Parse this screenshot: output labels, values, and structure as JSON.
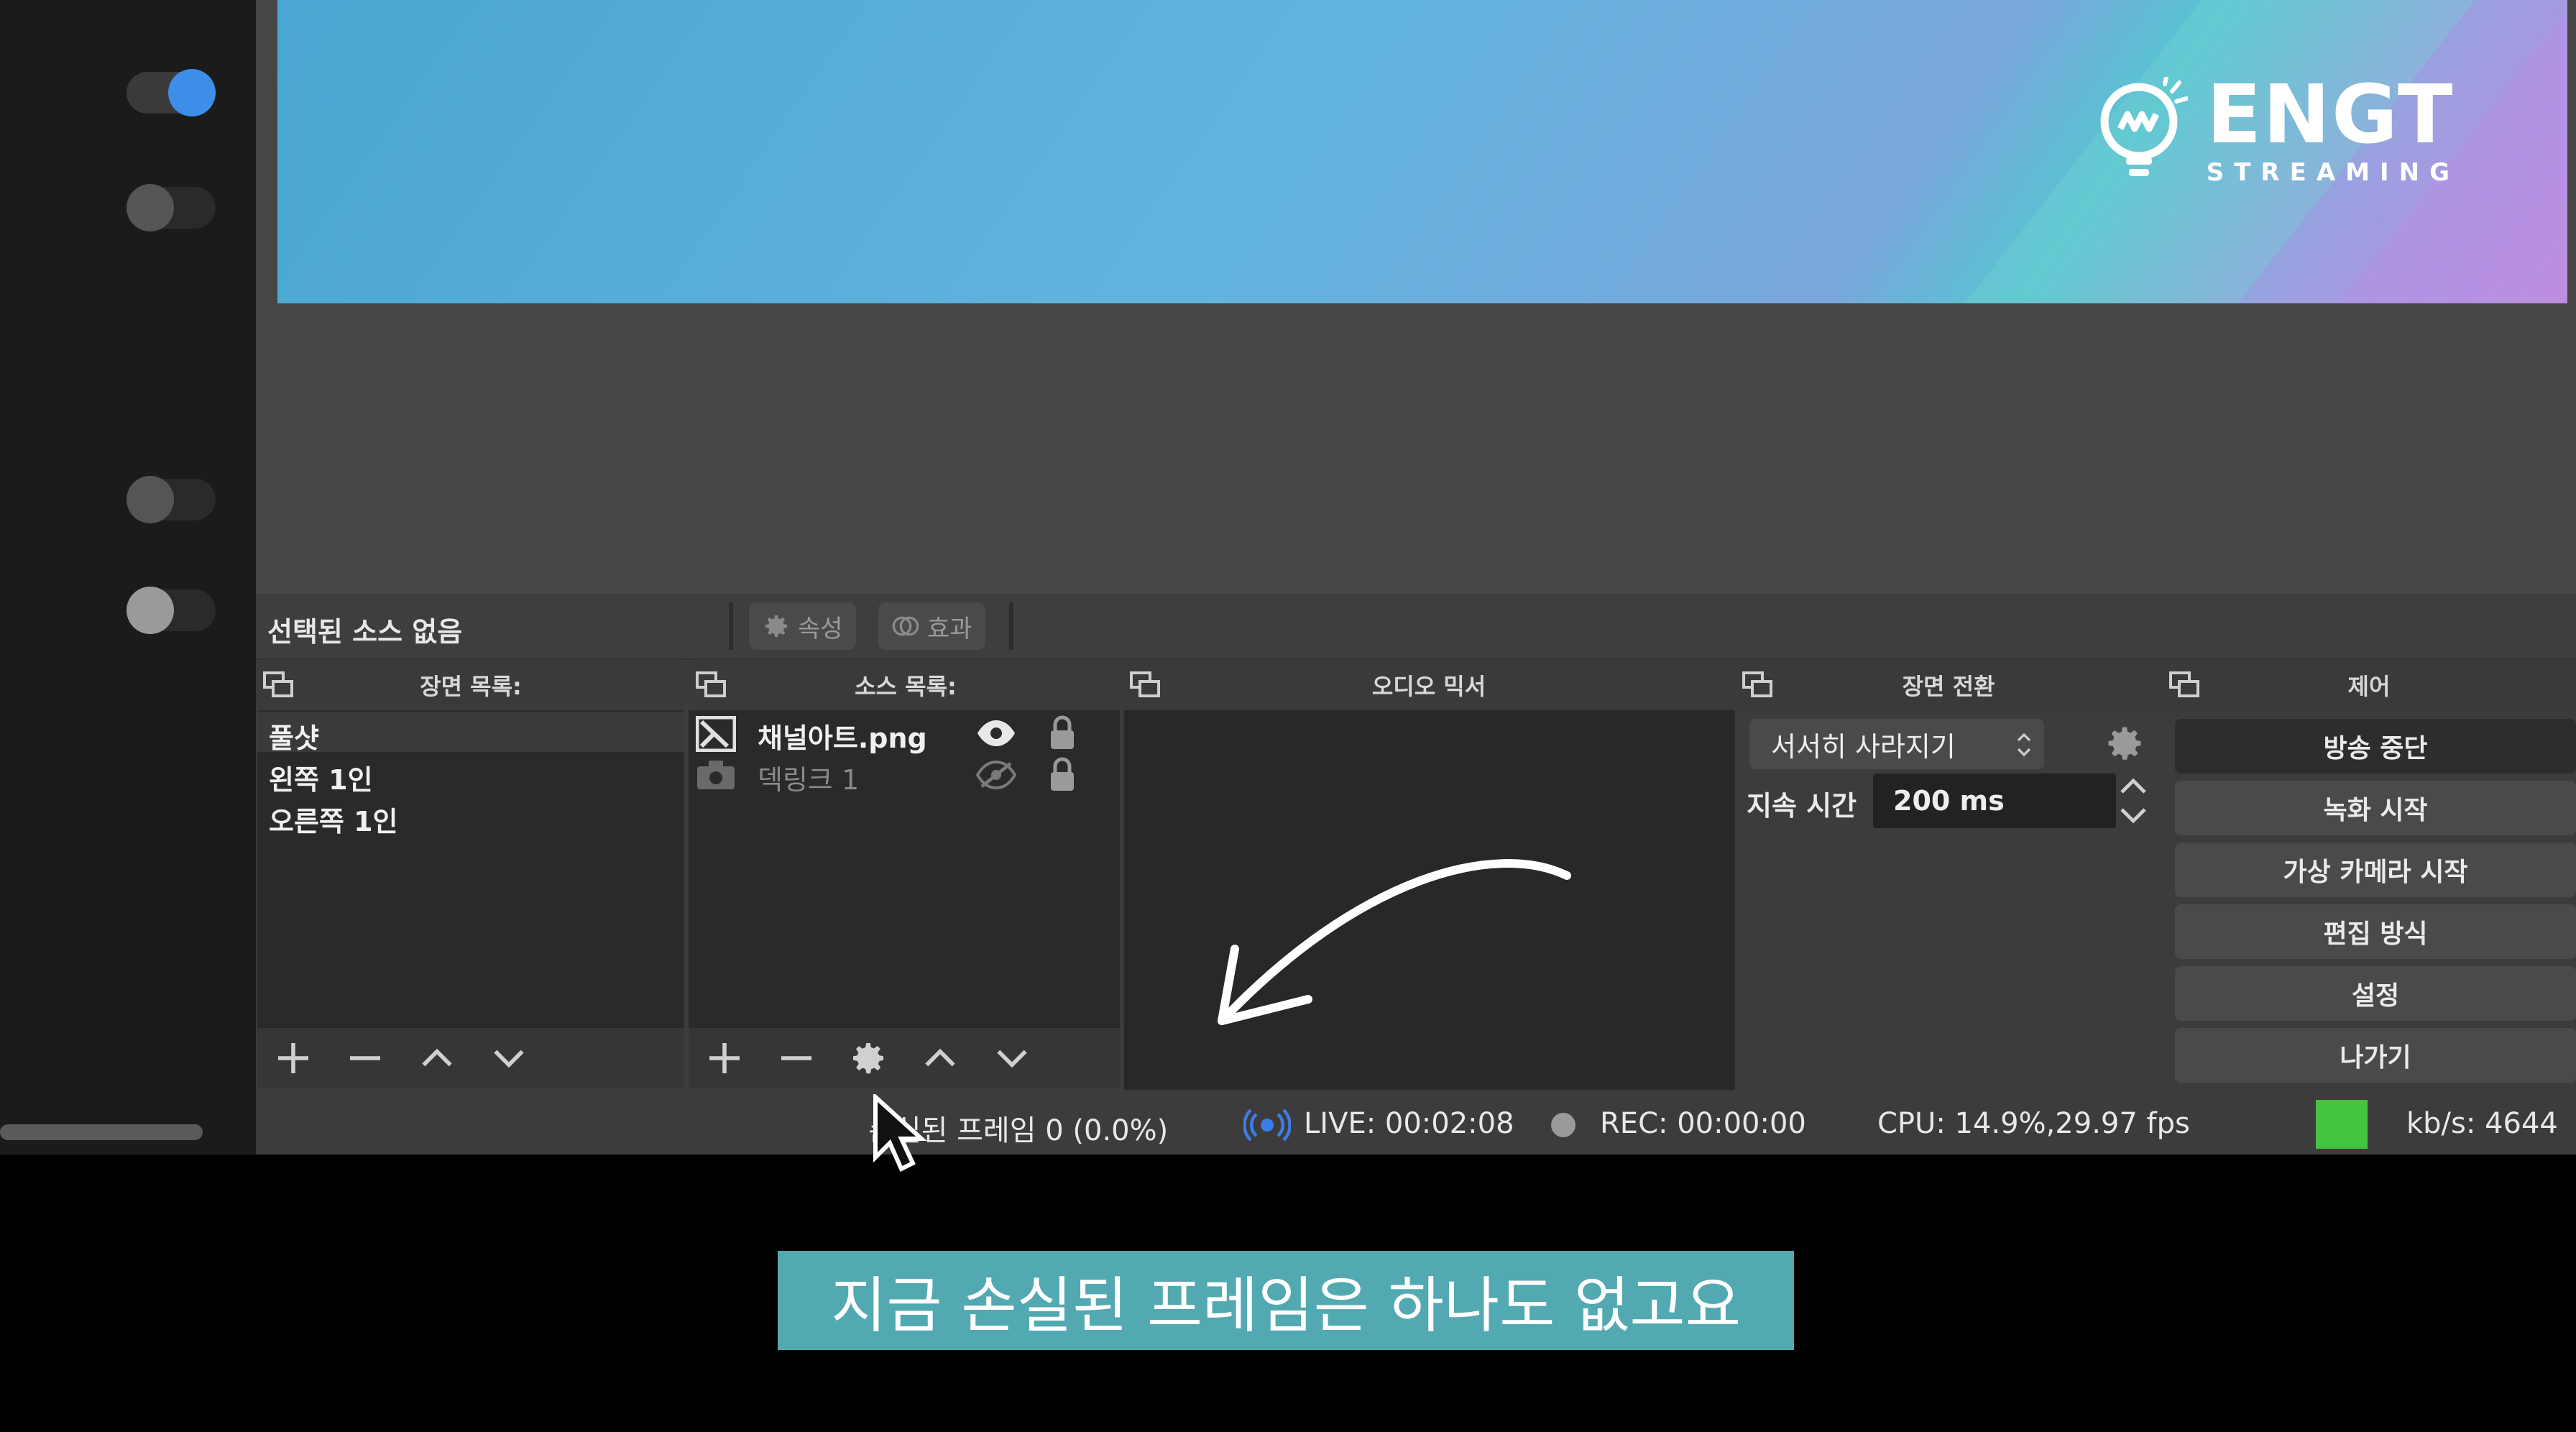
{
  "left_strip": {
    "toggles": [
      {
        "state": "on"
      },
      {
        "state": "off"
      },
      {
        "state": "off"
      },
      {
        "state": "off-light"
      }
    ]
  },
  "preview": {
    "logo_name": "ENGT",
    "logo_sub": "STREAMING"
  },
  "source_toolbar": {
    "no_source_label": "선택된 소스 없음",
    "properties_label": "속성",
    "filters_label": "효과"
  },
  "docks": {
    "scenes": {
      "title": "장면 목록:",
      "items": [
        "풀샷",
        "왼쪽 1인",
        "오른쪽 1인"
      ],
      "selected_index": 0
    },
    "sources": {
      "title": "소스 목록:",
      "items": [
        {
          "name": "채널아트.png",
          "visible": true,
          "locked": true
        },
        {
          "name": "덱링크 1",
          "visible": false,
          "locked": true
        }
      ]
    },
    "audio_mixer": {
      "title": "오디오 믹서"
    },
    "transitions": {
      "title": "장면 전환",
      "selected": "서서히 사라지기",
      "duration_label": "지속 시간",
      "duration_value": "200 ms"
    },
    "controls": {
      "title": "제어",
      "buttons": [
        "방송 중단",
        "녹화 시작",
        "가상 카메라 시작",
        "편집 방식",
        "설정",
        "나가기"
      ]
    }
  },
  "status_bar": {
    "dropped_frames": "손실된 프레임 0 (0.0%)",
    "live": "LIVE: 00:02:08",
    "rec": "REC: 00:00:00",
    "cpu": "CPU: 14.9%,29.97 fps",
    "bitrate": "kb/s: 4644",
    "indicator_color": "#43c43c",
    "live_icon_color": "#3d7de8"
  },
  "subtitle": {
    "text": "지금 손실된 프레임은 하나도 없고요",
    "bg_color": "#52a9b1"
  }
}
